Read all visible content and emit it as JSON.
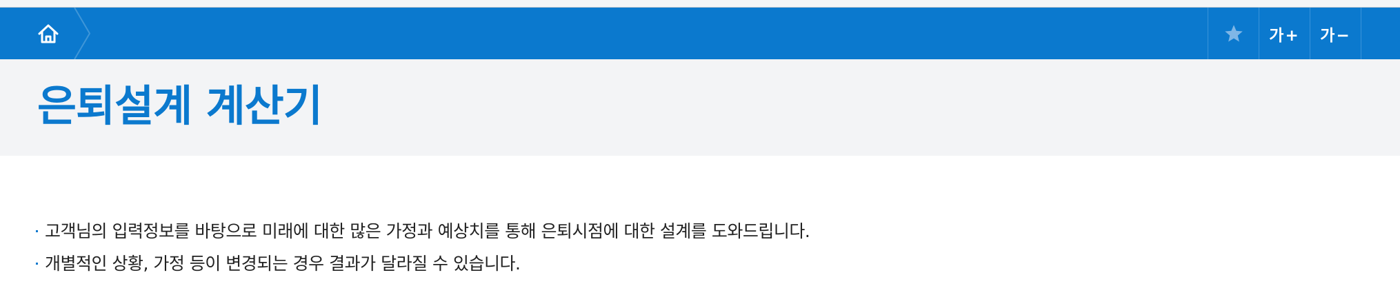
{
  "nav": {
    "home_icon": "home-icon",
    "tools": [
      {
        "icon": "star-icon",
        "label": ""
      },
      {
        "label": "가+"
      },
      {
        "label": "가−"
      }
    ]
  },
  "page": {
    "title": "은퇴설계 계산기"
  },
  "description": {
    "items": [
      "고객님의 입력정보를 바탕으로 미래에 대한 많은 가정과 예상치를 통해 은퇴시점에 대한 설계를 도와드립니다.",
      "개별적인 상황, 가정 등이 변경되는 경우 결과가 달라질 수 있습니다."
    ]
  },
  "colors": {
    "brand_blue": "#0b79ce",
    "title_band_bg": "#f3f4f6",
    "star": "#7fb6e6"
  }
}
